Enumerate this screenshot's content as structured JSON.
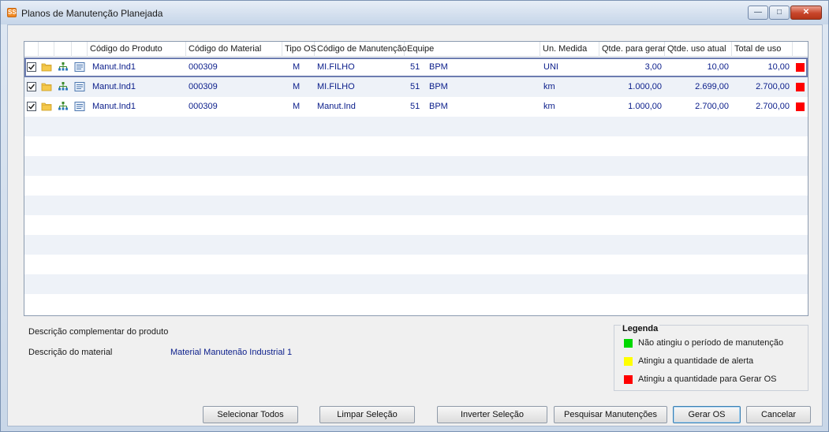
{
  "window": {
    "title": "Planos de Manutenção Planejada",
    "app_icon": "SS",
    "minimize_glyph": "—",
    "maximize_glyph": "□",
    "close_glyph": "✕"
  },
  "grid": {
    "columns": [
      "Código do Produto",
      "Código do Material",
      "Tipo OS",
      "Código de Manutenção",
      "Equipe",
      "Un. Medida",
      "Qtde. para gerar",
      "Qtde. uso atual",
      "Total de uso"
    ],
    "rows": [
      {
        "checked": true,
        "produto": "Manut.Ind1",
        "material": "000309",
        "tipo_os": "M",
        "manutencao": "MI.FILHO",
        "equipe_num": "51",
        "equipe_nome": "BPM",
        "un_medida": "UNI",
        "qtde_gerar": "3,00",
        "qtde_atual": "10,00",
        "total_uso": "10,00",
        "status_color": "#ff0000"
      },
      {
        "checked": true,
        "produto": "Manut.Ind1",
        "material": "000309",
        "tipo_os": "M",
        "manutencao": "MI.FILHO",
        "equipe_num": "51",
        "equipe_nome": "BPM",
        "un_medida": "km",
        "qtde_gerar": "1.000,00",
        "qtde_atual": "2.699,00",
        "total_uso": "2.700,00",
        "status_color": "#ff0000"
      },
      {
        "checked": true,
        "produto": "Manut.Ind1",
        "material": "000309",
        "tipo_os": "M",
        "manutencao": "Manut.Ind",
        "equipe_num": "51",
        "equipe_nome": "BPM",
        "un_medida": "km",
        "qtde_gerar": "1.000,00",
        "qtde_atual": "2.700,00",
        "total_uso": "2.700,00",
        "status_color": "#ff0000"
      }
    ]
  },
  "details": {
    "desc_produto_label": "Descrição complementar do produto",
    "desc_produto_value": "",
    "desc_material_label": "Descrição do material",
    "desc_material_value": "Material Manutenão Industrial 1"
  },
  "legend": {
    "title": "Legenda",
    "items": [
      {
        "color": "#00d800",
        "text": "Não atingiu o período de manutenção"
      },
      {
        "color": "#ffff00",
        "text": "Atingiu a quantidade de alerta"
      },
      {
        "color": "#ff0000",
        "text": "Atingiu a quantidade para Gerar OS"
      }
    ]
  },
  "buttons": {
    "select_all": "Selecionar Todos",
    "clear": "Limpar Seleção",
    "invert": "Inverter Seleção",
    "search": "Pesquisar Manutenções",
    "generate": "Gerar OS",
    "cancel": "Cancelar"
  }
}
